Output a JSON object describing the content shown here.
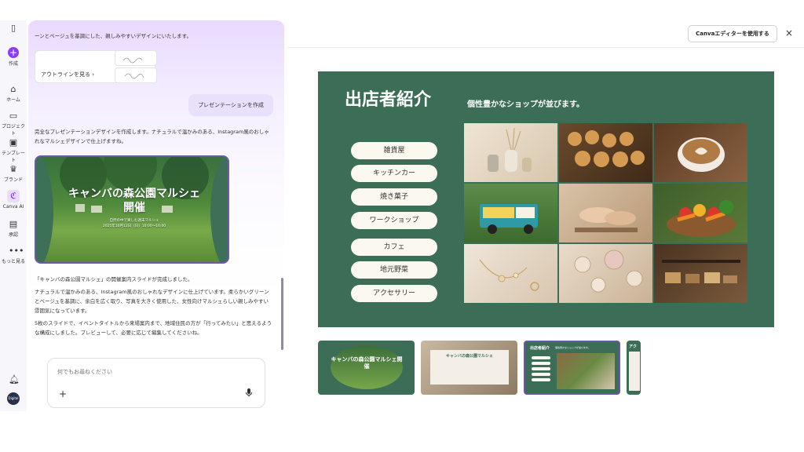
{
  "rail": {
    "create": "作成",
    "home": "ホーム",
    "projects": "プロジェクト",
    "templates": "テンプレート",
    "brand": "ブランド",
    "canva_ai": "Canva AI",
    "approvals": "承認",
    "more": "もっと見る",
    "avatar_text": "Digital"
  },
  "chat": {
    "top_text": "ーンとベージュを基調にした、親しみやすいデザインにいたします。",
    "outline_button": "アウトラインを見る ›",
    "user_message": "プレゼンテーションを作成",
    "ai_message_1": "完全なプレゼンテーションデザインを作成します。ナチュラルで温かみのある、Instagram風のおしゃれなマルシェデザインで仕上げますね。",
    "preview": {
      "title": "キャンバの森公園マルシェ開催",
      "subtitle_1": "自然の中で楽しむ週末マルシェ",
      "subtitle_2": "2025年10月12日（日）10:00〜16:00"
    },
    "ai_message_2": "「キャンバの森公園マルシェ」の開催案内スライドが完成しました。",
    "ai_message_3": "ナチュラルで温かみのある、Instagram風のおしゃれなデザインに仕上げています。柔らかいグリーンとベージュを基調に、余白を広く取り、写真を大きく使用した、女性向けマルシェらしい親しみやすい雰囲気になっています。",
    "ai_message_4": "5枚のスライドで、イベントタイトルから来場案内まで、地域住民の方が「行ってみたい」と思えるような構成にしました。プレビューして、必要に応じて編集してくださいね。",
    "input_placeholder": "何でもお尋ねください"
  },
  "toolbar": {
    "editor_button": "Canvaエディターを使用する",
    "close_icon": "×"
  },
  "slide": {
    "title": "出店者紹介",
    "subtitle": "個性豊かなショップが並びます。",
    "tags": [
      "雑貨屋",
      "キッチンカー",
      "焼き菓子",
      "ワークショップ",
      "カフェ",
      "地元野菜",
      "アクセサリー"
    ]
  },
  "thumbnails": [
    {
      "title": "キャンバの森公園マルシェ開催"
    },
    {
      "title": "キャンバの森公園マルシェ"
    },
    {
      "title": "出店者紹介",
      "subtitle": "個性豊かなショップが並びます。"
    },
    {
      "title": "アク"
    }
  ],
  "colors": {
    "accent": "#8b3dff",
    "slide_green": "#3c6d56",
    "pill": "#fbf8ef",
    "selection": "#6a56a6"
  }
}
